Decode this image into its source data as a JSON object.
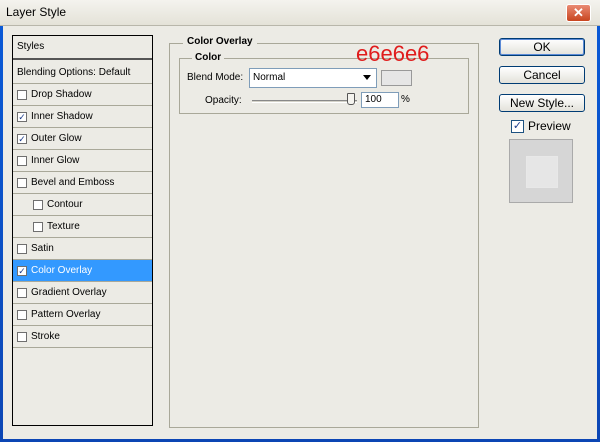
{
  "window": {
    "title": "Layer Style",
    "close_label": "✕"
  },
  "styles_list": {
    "header": "Styles",
    "items": [
      {
        "label": "Blending Options: Default",
        "has_checkbox": false,
        "checked": false,
        "indent": false,
        "selected": false
      },
      {
        "label": "Drop Shadow",
        "has_checkbox": true,
        "checked": false,
        "indent": false,
        "selected": false
      },
      {
        "label": "Inner Shadow",
        "has_checkbox": true,
        "checked": true,
        "indent": false,
        "selected": false
      },
      {
        "label": "Outer Glow",
        "has_checkbox": true,
        "checked": true,
        "indent": false,
        "selected": false
      },
      {
        "label": "Inner Glow",
        "has_checkbox": true,
        "checked": false,
        "indent": false,
        "selected": false
      },
      {
        "label": "Bevel and Emboss",
        "has_checkbox": true,
        "checked": false,
        "indent": false,
        "selected": false
      },
      {
        "label": "Contour",
        "has_checkbox": true,
        "checked": false,
        "indent": true,
        "selected": false
      },
      {
        "label": "Texture",
        "has_checkbox": true,
        "checked": false,
        "indent": true,
        "selected": false
      },
      {
        "label": "Satin",
        "has_checkbox": true,
        "checked": false,
        "indent": false,
        "selected": false
      },
      {
        "label": "Color Overlay",
        "has_checkbox": true,
        "checked": true,
        "indent": false,
        "selected": true
      },
      {
        "label": "Gradient Overlay",
        "has_checkbox": true,
        "checked": false,
        "indent": false,
        "selected": false
      },
      {
        "label": "Pattern Overlay",
        "has_checkbox": true,
        "checked": false,
        "indent": false,
        "selected": false
      },
      {
        "label": "Stroke",
        "has_checkbox": true,
        "checked": false,
        "indent": false,
        "selected": false
      }
    ]
  },
  "color_overlay": {
    "section_title": "Color Overlay",
    "group_title": "Color",
    "blend_mode_label": "Blend Mode:",
    "blend_mode_value": "Normal",
    "overlay_color": "#e6e6e6",
    "annotation": "e6e6e6",
    "opacity_label": "Opacity:",
    "opacity_value": "100",
    "opacity_unit": "%"
  },
  "buttons": {
    "ok": "OK",
    "cancel": "Cancel",
    "new_style": "New Style..."
  },
  "preview": {
    "label": "Preview",
    "checked": true
  }
}
